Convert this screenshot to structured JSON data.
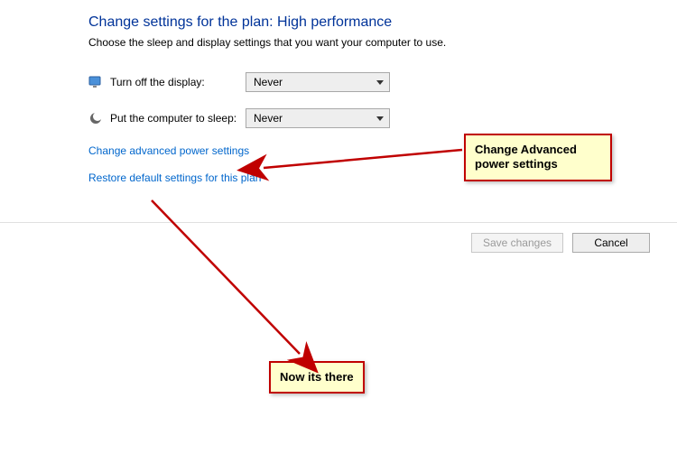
{
  "header": {
    "title": "Change settings for the plan: High performance",
    "subtitle": "Choose the sleep and display settings that you want your computer to use."
  },
  "settings": {
    "display_off": {
      "label": "Turn off the display:",
      "value": "Never"
    },
    "sleep": {
      "label": "Put the computer to sleep:",
      "value": "Never"
    }
  },
  "links": {
    "advanced": "Change advanced power settings",
    "restore": "Restore default settings for this plan"
  },
  "buttons": {
    "save": "Save changes",
    "cancel": "Cancel"
  },
  "annotations": {
    "callout1_line1": "Change Advanced",
    "callout1_line2": "power settings",
    "callout2": "Now its there"
  },
  "icons": {
    "display": "monitor-icon",
    "sleep": "moon-icon"
  },
  "colors": {
    "accent": "#c00000",
    "link": "#0066cc",
    "title": "#003399"
  }
}
